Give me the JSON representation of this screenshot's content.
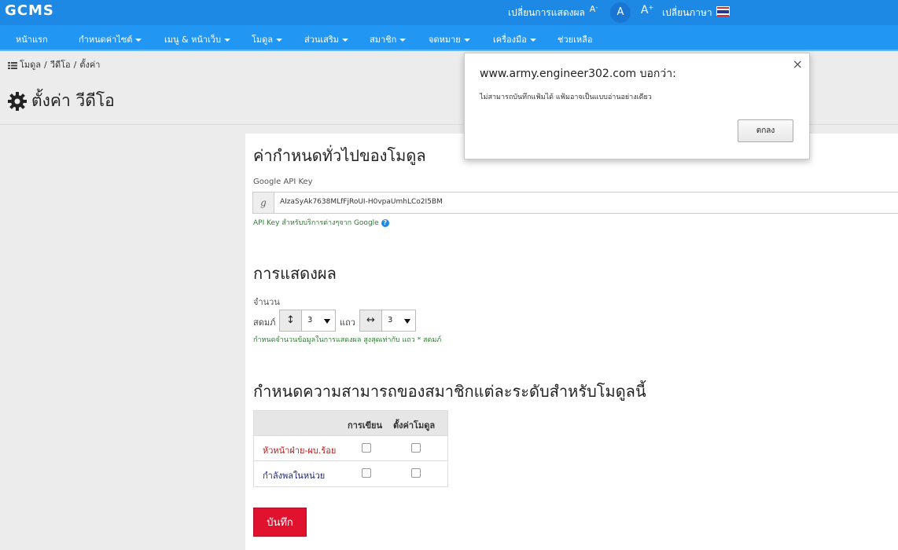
{
  "header": {
    "logo": "GCMS",
    "display_toggle": "เปลี่ยนการแสดงผล",
    "font_small": "A",
    "font_normal": "A",
    "font_large": "A",
    "font_small_sup": "-",
    "font_large_sup": "+",
    "language_label": "เปลี่ยนภาษา"
  },
  "nav": {
    "items": [
      {
        "label": "หน้าแรก"
      },
      {
        "label": "กำหนดค่าไซต์"
      },
      {
        "label": "เมนู & หน้าเว็บ"
      },
      {
        "label": "โมดูล"
      },
      {
        "label": "ส่วนเสริม"
      },
      {
        "label": "สมาชิก"
      },
      {
        "label": "จดหมาย"
      },
      {
        "label": "เครื่องมือ"
      },
      {
        "label": "ช่วยเหลือ"
      }
    ]
  },
  "breadcrumb": {
    "items": [
      "โมดูล",
      "วีดีโอ",
      "ตั้งค่า"
    ],
    "separator": "/"
  },
  "page": {
    "title": "ตั้งค่า วีดีโอ"
  },
  "general": {
    "heading": "ค่ากำหนดทั่วไปของโมดูล",
    "api_key_label": "Google API Key",
    "api_key_addon": "g",
    "api_key_value": "AIzaSyAk7638MLfFjRoUI-H0vpaUmhLCo2I5BM",
    "api_key_hint": "API Key สำหรับบริการต่างๆจาก Google",
    "help_glyph": "?"
  },
  "display": {
    "heading": "การแสดงผล",
    "count_label": "จำนวน",
    "columns_label": "สดมภ์",
    "columns_value": "3",
    "rows_label": "แถว",
    "rows_value": "3",
    "hint": "กำหนดจำนวนข้อมูลในการแสดงผล สูงสุดเท่ากับ แถว * สดมภ์"
  },
  "permissions": {
    "heading": "กำหนดความสามารถของสมาชิกแต่ละระดับสำหรับโมดูลนี้",
    "col_write": "การเขียน",
    "col_config": "ตั้งค่าโมดูล",
    "rows": [
      {
        "role": "หัวหน้าฝ่าย-ผบ.ร้อย",
        "color": "#b71c1c"
      },
      {
        "role": "กำลังพลในหน่วย",
        "color": "#1a237e"
      }
    ]
  },
  "save_label": "บันทึก",
  "dialog": {
    "origin": "www.army.engineer302.com บอกว่า:",
    "message": "ไม่สามารถบันทึกแฟ้มได้ แฟ้มอาจเป็นแบบอ่านอย่างเดียว",
    "ok_label": "ตกลง",
    "close_glyph": "×"
  },
  "colors": {
    "topbar": "#1e88e5",
    "navbar": "#2196f3",
    "save_button": "#e0122d"
  }
}
